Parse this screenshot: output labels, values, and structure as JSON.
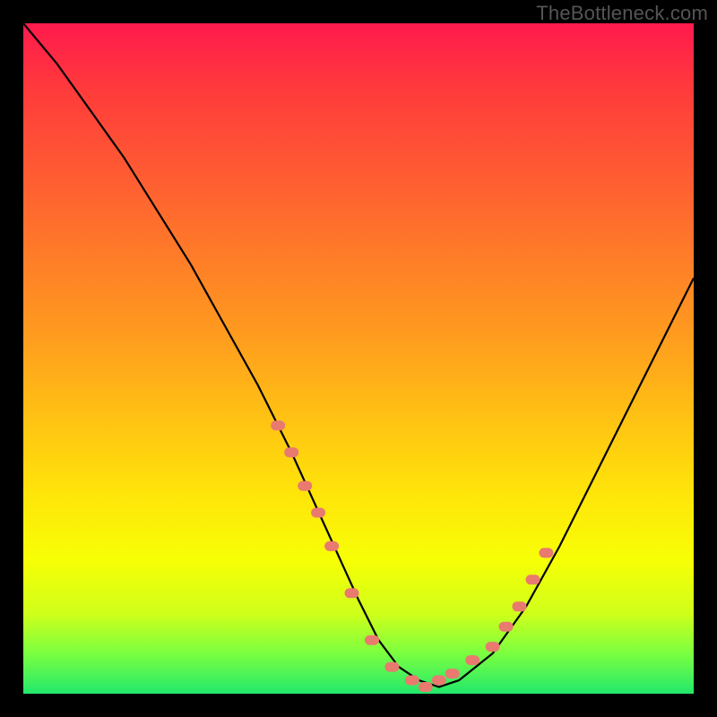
{
  "watermark": "TheBottleneck.com",
  "chart_data": {
    "type": "line",
    "title": "",
    "xlabel": "",
    "ylabel": "",
    "xlim": [
      0,
      100
    ],
    "ylim": [
      0,
      100
    ],
    "series": [
      {
        "name": "bottleneck-curve",
        "x": [
          0,
          5,
          10,
          15,
          20,
          25,
          30,
          35,
          40,
          45,
          50,
          53,
          56,
          59,
          62,
          65,
          70,
          75,
          80,
          85,
          90,
          95,
          100
        ],
        "values": [
          100,
          94,
          87,
          80,
          72,
          64,
          55,
          46,
          36,
          25,
          14,
          8,
          4,
          2,
          1,
          2,
          6,
          13,
          22,
          32,
          42,
          52,
          62
        ]
      }
    ],
    "highlight_points": {
      "name": "markers",
      "x": [
        38,
        40,
        42,
        44,
        46,
        49,
        52,
        55,
        58,
        60,
        62,
        64,
        67,
        70,
        72,
        74,
        76,
        78
      ],
      "values": [
        40,
        36,
        31,
        27,
        22,
        15,
        8,
        4,
        2,
        1,
        2,
        3,
        5,
        7,
        10,
        13,
        17,
        21
      ]
    },
    "colors": {
      "curve": "#000000",
      "markers": "#e97a6f",
      "gradient_top": "#ff1a4d",
      "gradient_bottom": "#22e86b"
    }
  }
}
